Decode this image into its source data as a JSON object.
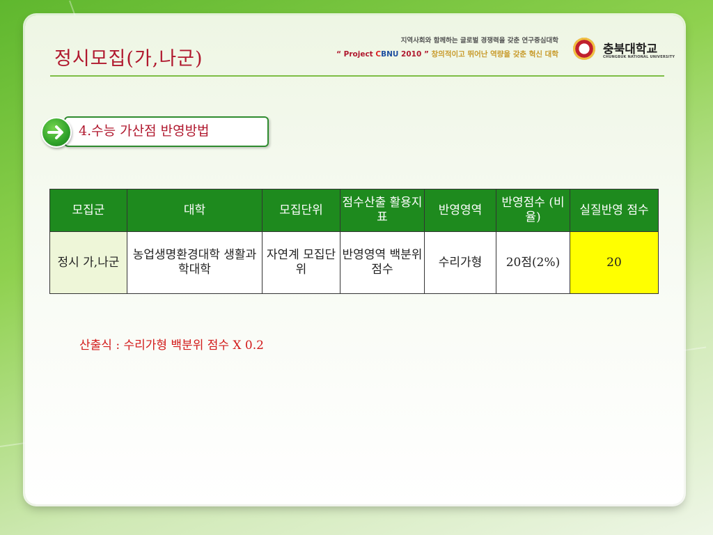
{
  "slide": {
    "title": "정시모집(가,나군)",
    "section_heading": "4.수능 가산점 반영방법",
    "formula": "산출식 : 수리가형 백분위 점수 X 0.2"
  },
  "header": {
    "slogan_line1": "지역사회와 함께하는 글로벌 경쟁력을 갖춘 연구중심대학",
    "slogan_quote_open": "“ Project ",
    "slogan_c": "C",
    "slogan_bnu": "BNU",
    "slogan_year": " 2010 ”",
    "slogan_tail": "창의적이고 뛰어난 역량을 갖춘 혁신 대학",
    "university_name": "충북대학교",
    "university_name_en": "CHUNGBUK NATIONAL UNIVERSITY"
  },
  "table": {
    "headers": [
      "모집군",
      "대학",
      "모집단위",
      "점수산출 활용지표",
      "반영영역",
      "반영점수 (비율)",
      "실질반영 점수"
    ],
    "rows": [
      [
        "정시 가,나군",
        "농업생명환경대학 생활과학대학",
        "자연계 모집단위",
        "반영영역 백분위점수",
        "수리가형",
        "20점(2%)",
        "20"
      ]
    ]
  },
  "colors": {
    "title": "#b0182e",
    "header_fill": "#1e8a1e",
    "highlight": "#ffff00",
    "formula": "#d21a1a"
  }
}
